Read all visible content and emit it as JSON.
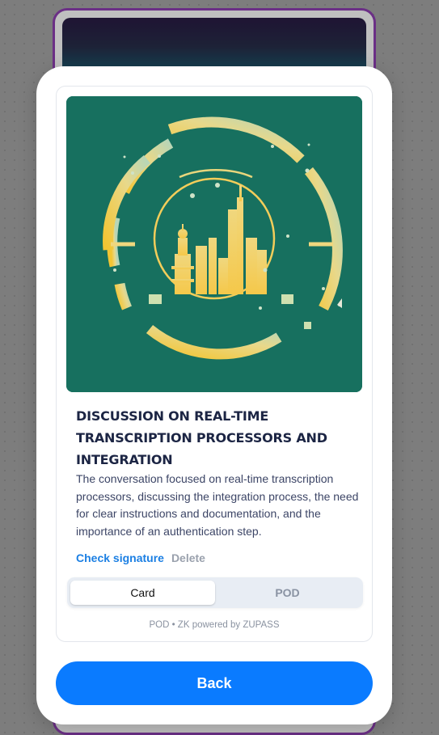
{
  "pod": {
    "image_alt": "city skyline emblem artwork",
    "title": "DISCUSSION ON REAL-TIME TRANSCRIPTION PROCESSORS AND INTEGRATION",
    "description": "The conversation focused on real-time transcription processors, discussing the integration process, the need for clear instructions and documentation, and the importance of an authentication step.",
    "actions": {
      "check_signature": "Check signature",
      "delete": "Delete"
    },
    "view_toggle": {
      "options": [
        "Card",
        "POD"
      ],
      "selected": "Card"
    },
    "footer": "POD • ZK powered by ZUPASS"
  },
  "back_button": "Back",
  "colors": {
    "accent": "#0a7bff",
    "link": "#1b7fe3",
    "title": "#1c2544",
    "art_background": "#17705f",
    "background_card_border": "#6b2f86"
  }
}
